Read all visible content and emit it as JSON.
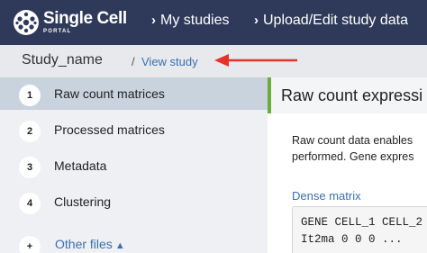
{
  "navbar": {
    "brand": "Single Cell",
    "brand_sub": "PORTAL",
    "links": [
      {
        "label": "My studies",
        "icon": "chevron-right-icon"
      },
      {
        "label": "Upload/Edit study data",
        "icon": "chevron-right-icon"
      }
    ]
  },
  "breadcrumb": {
    "study_name": "Study_name",
    "separator": "/",
    "view_study": "View study"
  },
  "annotation": {
    "arrow_color": "#e5332a"
  },
  "sidebar": {
    "steps": [
      {
        "number": "1",
        "label": "Raw count matrices",
        "active": true
      },
      {
        "number": "2",
        "label": "Processed matrices",
        "active": false
      },
      {
        "number": "3",
        "label": "Metadata",
        "active": false
      },
      {
        "number": "4",
        "label": "Clustering",
        "active": false
      }
    ],
    "other_files": {
      "number": "+",
      "label": "Other files",
      "icon": "caret-up-icon"
    }
  },
  "main": {
    "title": "Raw count expressi",
    "description_lines": [
      "Raw count data enables",
      "performed. Gene expres"
    ],
    "section_title": "Dense matrix",
    "code_lines": [
      "GENE CELL_1 CELL_2",
      "It2ma 0 0 0 ..."
    ]
  },
  "colors": {
    "navbar": "#2f3a5a",
    "active_step": "#c8d3de",
    "accent_green": "#6aad3b",
    "link": "#3a6fb0"
  }
}
